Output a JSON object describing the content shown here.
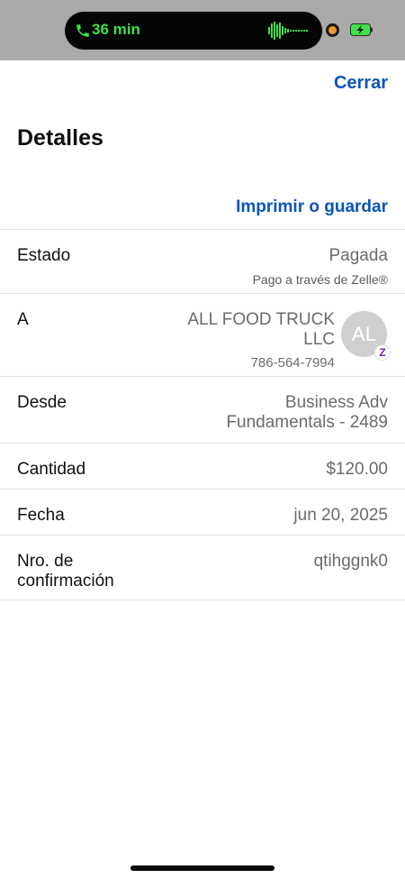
{
  "status_bar": {
    "call_time": "36 min",
    "accent_color": "#3ee04a"
  },
  "header": {
    "close_label": "Cerrar",
    "title": "Detalles",
    "print_label": "Imprimir o guardar",
    "link_color": "#0a56b8"
  },
  "details": {
    "estado": {
      "label": "Estado",
      "value": "Pagada",
      "sub": "Pago a través de Zelle®"
    },
    "a": {
      "label": "A",
      "name_line1": "ALL FOOD TRUCK",
      "name_line2": "LLC",
      "phone": "786-564-7994",
      "avatar_initials": "AL",
      "badge": "Z"
    },
    "desde": {
      "label": "Desde",
      "value_line1": "Business Adv",
      "value_line2": "Fundamentals - 2489"
    },
    "cantidad": {
      "label": "Cantidad",
      "value": "$120.00"
    },
    "fecha": {
      "label": "Fecha",
      "value": "jun 20, 2025"
    },
    "confirmacion": {
      "label_line1": "Nro. de",
      "label_line2": "confirmación",
      "value": "qtihggnk0"
    }
  },
  "icons": [
    "phone-icon",
    "waveform-icon",
    "camera-indicator-icon",
    "battery-charging-icon",
    "zelle-icon"
  ]
}
